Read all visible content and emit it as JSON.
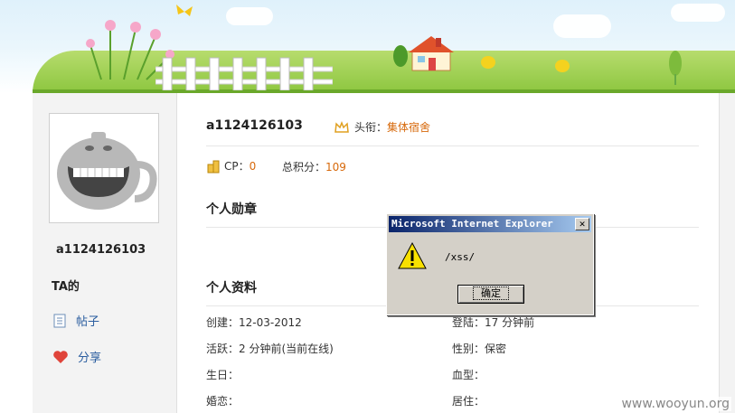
{
  "profile": {
    "username": "a1124126103",
    "title_label": "头衔：",
    "title_value": "集体宿舍",
    "cp_label": "CP：",
    "cp_value": "0",
    "score_label": "总积分：",
    "score_value": "109"
  },
  "sidebar": {
    "username": "a1124126103",
    "ta_label": "TA的",
    "links": [
      {
        "label": "帖子",
        "icon": "document-icon"
      },
      {
        "label": "分享",
        "icon": "heart-icon"
      }
    ]
  },
  "sections": {
    "medals": "个人勋章",
    "info": "个人资料"
  },
  "info_fields": {
    "created": "创建：12-03-2012",
    "login": "登陆：17 分钟前",
    "active": "活跃：2 分钟前(当前在线)",
    "gender": "性别：保密",
    "birthday": "生日：",
    "blood": "血型：",
    "marital": "婚恋：",
    "residence": "居住："
  },
  "dialog": {
    "title": "Microsoft Internet Explorer",
    "message": "/xss/",
    "ok_label": "确定",
    "close_glyph": "✕"
  },
  "watermark": "www.wooyun.org",
  "colors": {
    "accent_orange": "#d7690b",
    "link_blue": "#2a5d9f",
    "dialog_bg": "#d4d0c8",
    "titlebar": "#0a246a"
  }
}
